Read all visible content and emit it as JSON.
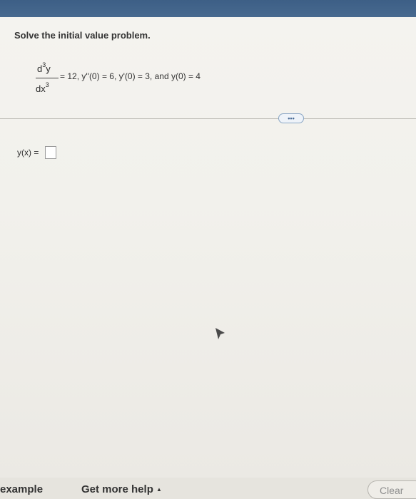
{
  "problem": {
    "prompt": "Solve the initial value problem.",
    "lhs_num": "d",
    "lhs_num_exp": "3",
    "lhs_num_var": "y",
    "lhs_den": "dx",
    "lhs_den_exp": "3",
    "rest": "= 12, y''(0) = 6, y'(0) = 3, and y(0) = 4"
  },
  "more_button": "•••",
  "answer": {
    "label": "y(x) =",
    "value": ""
  },
  "footer": {
    "example": "example",
    "get_help": "Get more help",
    "help_arrow": "▲",
    "clear": "Clear"
  },
  "icons": {
    "more": "ellipsis-icon",
    "cursor": "mouse-cursor-icon",
    "help": "caret-up-icon"
  },
  "colors": {
    "topbar": "#47698f",
    "accent": "#4a6c96"
  }
}
